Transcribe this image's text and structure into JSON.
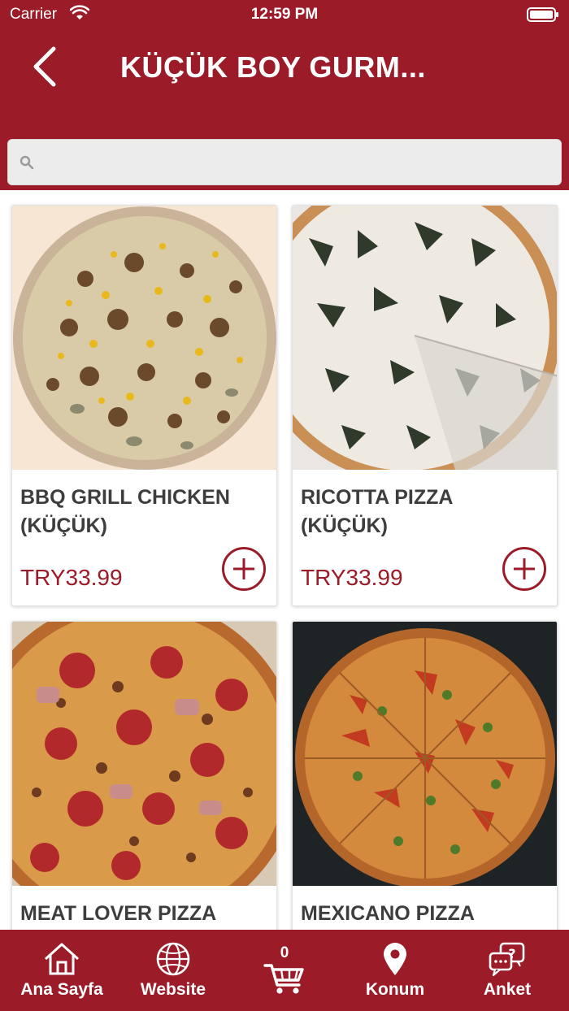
{
  "status_bar": {
    "carrier": "Carrier",
    "time": "12:59 PM"
  },
  "header": {
    "title": "KÜÇÜK BOY GURM...",
    "back_icon": "chevron-left-icon"
  },
  "search": {
    "placeholder": "",
    "value": "",
    "icon": "search-icon"
  },
  "products": [
    {
      "name": "BBQ GRILL CHICKEN (KÜÇÜK)",
      "price": "TRY33.99"
    },
    {
      "name": "RICOTTA PIZZA (KÜÇÜK)",
      "price": "TRY33.99"
    },
    {
      "name": "MEAT LOVER PIZZA",
      "price": ""
    },
    {
      "name": "MEXICANO PIZZA",
      "price": ""
    }
  ],
  "tabbar": {
    "items": [
      {
        "label": "Ana Sayfa",
        "icon": "home-icon"
      },
      {
        "label": "Website",
        "icon": "globe-icon"
      },
      {
        "label": "",
        "icon": "cart-icon",
        "badge": "0"
      },
      {
        "label": "Konum",
        "icon": "location-pin-icon"
      },
      {
        "label": "Anket",
        "icon": "survey-chat-icon"
      }
    ]
  },
  "colors": {
    "brand": "#9b1b28",
    "header_bg": "#9b1b28",
    "price": "#9b1b28",
    "title_text": "#ffffff",
    "product_name": "#3d3d3d"
  }
}
